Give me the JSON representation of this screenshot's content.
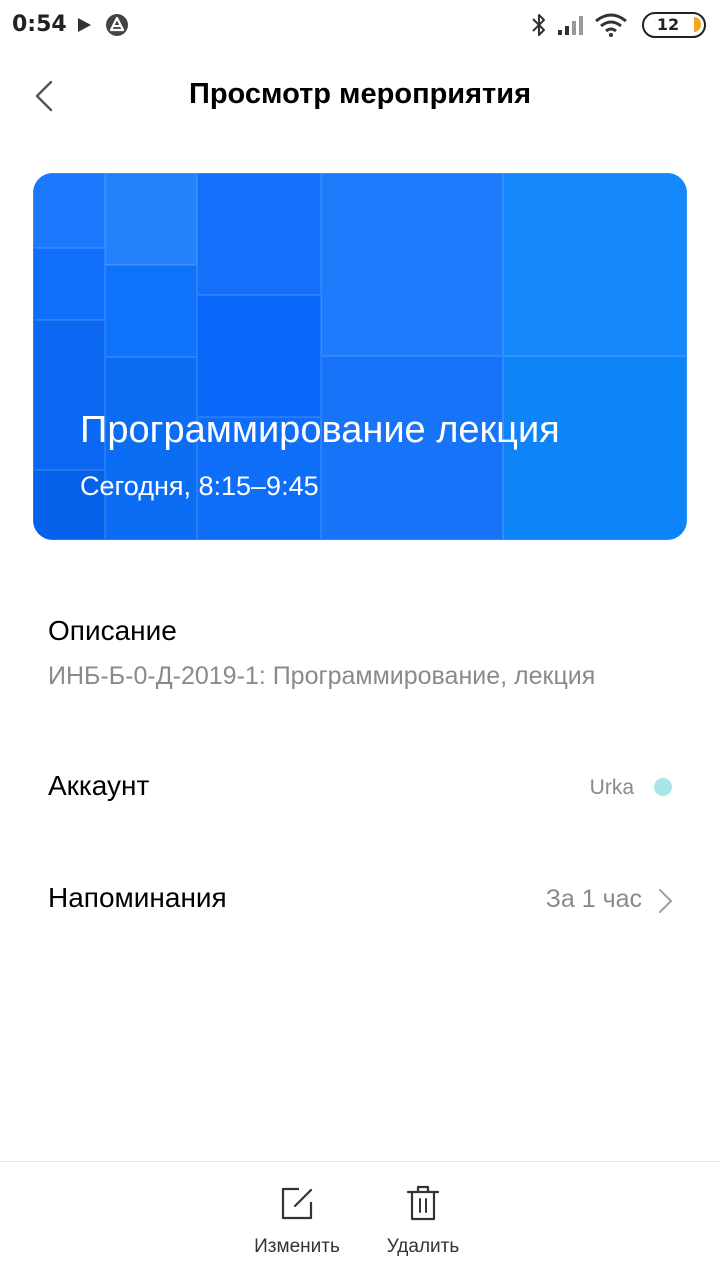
{
  "status_bar": {
    "time": "0:54",
    "battery_level": "12",
    "battery_color": "#f5a623"
  },
  "header": {
    "title": "Просмотр мероприятия",
    "back_icon": "chevron-left-icon"
  },
  "event": {
    "title": "Программирование лекция",
    "time": "Сегодня, 8:15–9:45",
    "card_color": "#1f7bfb"
  },
  "description": {
    "label": "Описание",
    "value": "ИНБ-Б-0-Д-2019-1: Программирование, лекция"
  },
  "account": {
    "label": "Аккаунт",
    "value": "Urka",
    "dot_color": "#a8e6ea"
  },
  "reminders": {
    "label": "Напоминания",
    "value": "За 1 час"
  },
  "bottom_actions": {
    "edit_label": "Изменить",
    "delete_label": "Удалить"
  }
}
